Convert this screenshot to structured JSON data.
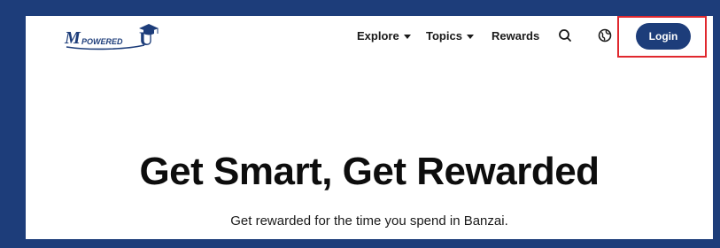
{
  "brand": {
    "logo_text": "MPOWERED",
    "logo_mark": "U",
    "color_primary": "#1d3d7a",
    "color_highlight": "#e0282e"
  },
  "nav": {
    "explore_label": "Explore",
    "topics_label": "Topics",
    "rewards_label": "Rewards",
    "search_icon": "search-icon",
    "globe_icon": "globe-icon",
    "login_label": "Login"
  },
  "hero": {
    "title": "Get Smart, Get Rewarded",
    "subtitle": "Get rewarded for the time you spend in Banzai."
  }
}
